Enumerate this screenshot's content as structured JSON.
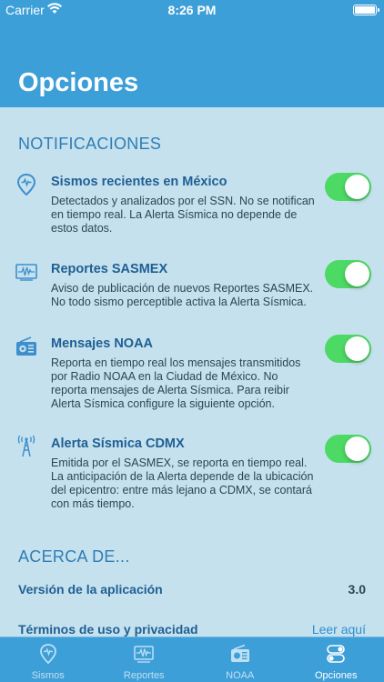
{
  "status_bar": {
    "carrier": "Carrier",
    "time": "8:26 PM"
  },
  "nav": {
    "title": "Opciones"
  },
  "notifications": {
    "header": "NOTIFICACIONES",
    "items": [
      {
        "icon": "map-pin-icon",
        "title": "Sismos recientes en México",
        "description": "Detectados y analizados por el SSN. No se notifican en tiempo real. La Alerta Sísmica no depende de estos datos.",
        "enabled": true
      },
      {
        "icon": "seismograph-icon",
        "title": "Reportes SASMEX",
        "description": "Aviso de publicación de nuevos Reportes SASMEX. No todo sismo perceptible activa la Alerta Sísmica.",
        "enabled": true
      },
      {
        "icon": "radio-icon",
        "title": "Mensajes NOAA",
        "description": "Reporta en tiempo real los mensajes transmitidos por Radio NOAA en la Ciudad de México. No reporta mensajes de Alerta Sísmica. Para reibir Alerta Sísmica configure la siguiente opción.",
        "enabled": true
      },
      {
        "icon": "antenna-icon",
        "title": "Alerta Sísmica CDMX",
        "description": "Emitida por el SASMEX, se reporta en tiempo real. La anticipación de la Alerta depende de la ubicación del epicentro: entre más lejano a CDMX, se contará con más tiempo.",
        "enabled": true
      }
    ]
  },
  "about": {
    "header": "ACERCA DE...",
    "version_label": "Versión de la aplicación",
    "version_value": "3.0",
    "terms_label": "Términos de uso y privacidad",
    "terms_link": "Leer aquí"
  },
  "tabs": [
    {
      "label": "Sismos",
      "icon": "map-pin-icon",
      "active": false
    },
    {
      "label": "Reportes",
      "icon": "seismograph-icon",
      "active": false
    },
    {
      "label": "NOAA",
      "icon": "radio-icon",
      "active": false
    },
    {
      "label": "Opciones",
      "icon": "toggles-icon",
      "active": true
    }
  ],
  "colors": {
    "brand": "#3d9fd8",
    "background": "#c5e1ee",
    "toggle_on": "#4cd964",
    "heading": "#2f7db5"
  }
}
